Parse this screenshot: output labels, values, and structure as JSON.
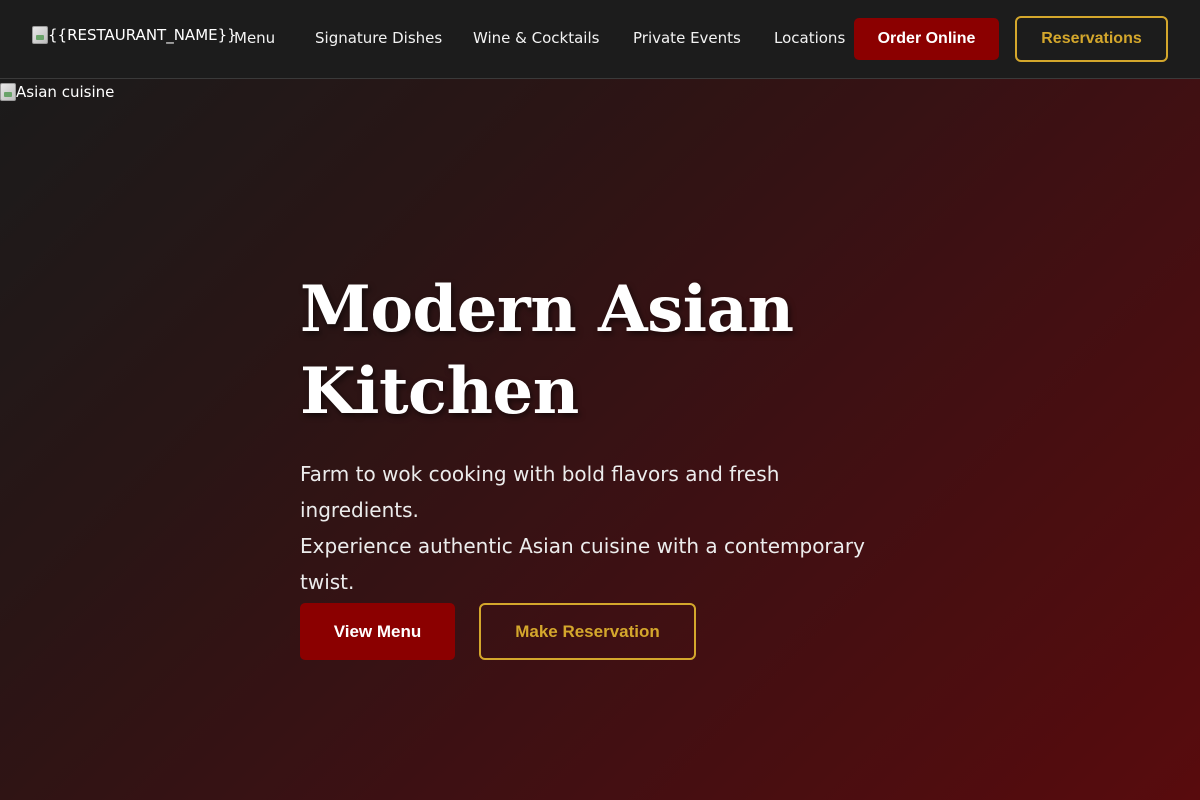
{
  "header": {
    "brand_alt": "{{RESTAURANT_NAME}}",
    "nav": [
      {
        "label": "Menu"
      },
      {
        "label": "Signature Dishes"
      },
      {
        "label": "Wine & Cocktails"
      },
      {
        "label": "Private Events"
      },
      {
        "label": "Locations"
      }
    ],
    "order_label": "Order Online",
    "reservations_label": "Reservations"
  },
  "hero": {
    "image_alt": "Asian cuisine",
    "title_line1": "Modern Asian",
    "title_line2": "Kitchen",
    "subtitle_line1": "Farm to wok cooking with bold flavors and fresh ingredients.",
    "subtitle_line2": "Experience authentic Asian cuisine with a contemporary",
    "subtitle_line3": "twist.",
    "primary_cta": "View Menu",
    "secondary_cta": "Make Reservation"
  },
  "colors": {
    "brand_red": "#8b0000",
    "accent_gold": "#d4a72c",
    "nav_bg": "#1c1c1c"
  }
}
